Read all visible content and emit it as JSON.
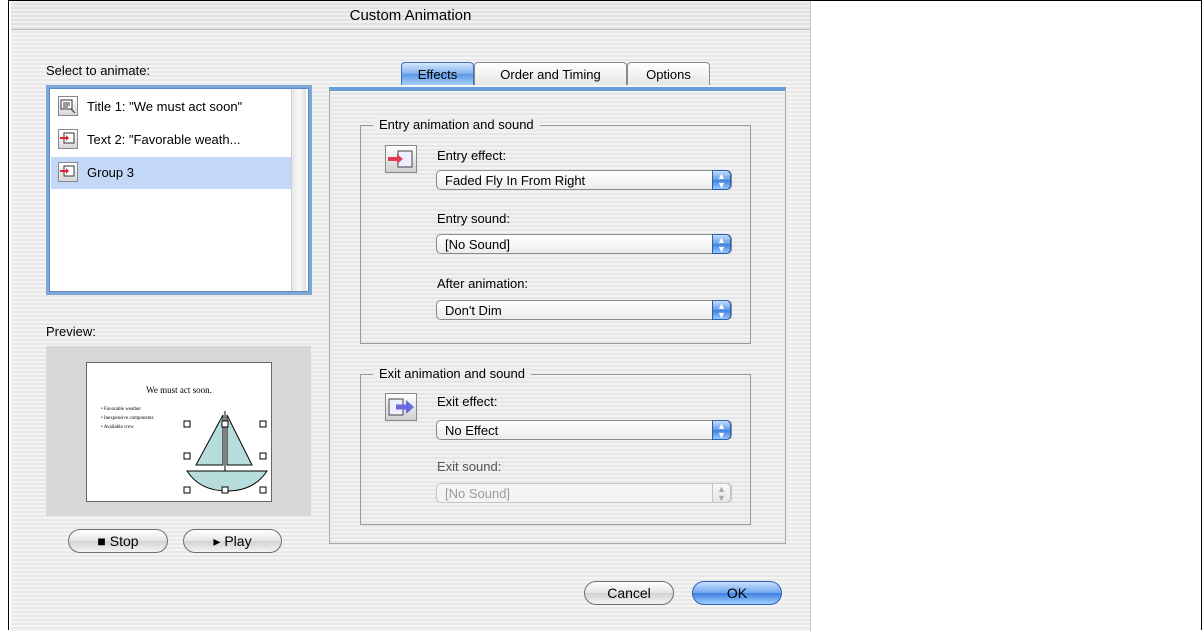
{
  "window": {
    "title": "Custom Animation"
  },
  "select_section": {
    "label": "Select to animate:"
  },
  "object_list": {
    "items": [
      {
        "label": "Title 1: \"We must act soon\"",
        "icon": "animate-title-icon",
        "selected": false
      },
      {
        "label": "Text 2: \"Favorable weath...",
        "icon": "animate-text-icon",
        "selected": false
      },
      {
        "label": "Group 3",
        "icon": "animate-group-icon",
        "selected": true
      }
    ]
  },
  "preview": {
    "label": "Preview:",
    "slide_title": "We must act soon.",
    "bullets": [
      "• Favorable weather",
      "• Inexpensive components",
      "• Available crew"
    ]
  },
  "playback": {
    "stop_label": "■ Stop",
    "play_label": "▸ Play"
  },
  "tabs": [
    {
      "label": "Effects",
      "active": true
    },
    {
      "label": "Order and Timing",
      "active": false
    },
    {
      "label": "Options",
      "active": false
    }
  ],
  "entry": {
    "group_title": "Entry animation and sound",
    "effect_label": "Entry effect:",
    "effect_value": "Faded Fly In From Right",
    "sound_label": "Entry sound:",
    "sound_value": "[No Sound]",
    "after_label": "After animation:",
    "after_value": "Don't Dim"
  },
  "exit": {
    "group_title": "Exit animation and sound",
    "effect_label": "Exit effect:",
    "effect_value": "No Effect",
    "sound_label": "Exit sound:",
    "sound_value": "[No Sound]",
    "sound_disabled": true
  },
  "footer": {
    "cancel_label": "Cancel",
    "ok_label": "OK"
  },
  "colors": {
    "accent": "#5c97e4",
    "selection": "#c2d8f6"
  }
}
